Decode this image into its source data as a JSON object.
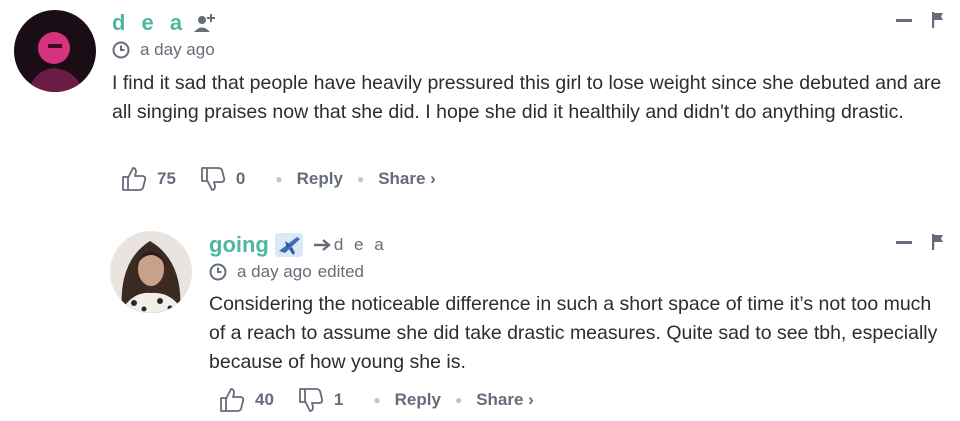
{
  "comments": [
    {
      "author": "d e a",
      "time": "a day ago",
      "text": "I find it sad that people have heavily pressured this girl to lose weight since she debuted and are all singing praises now that she did. I hope she did it healthily and didn't do anything drastic.",
      "upvotes": "75",
      "downvotes": "0",
      "reply_label": "Reply",
      "share_label": "Share ›"
    },
    {
      "author": "going",
      "reply_to": "d e a",
      "time": "a day ago",
      "edited": "edited",
      "text": "Considering the noticeable difference in such a short space of time it’s not too much of a reach to assume she did take drastic measures. Quite sad to see tbh, especially because of how young she is.",
      "upvotes": "40",
      "downvotes": "1",
      "reply_label": "Reply",
      "share_label": "Share ›"
    }
  ],
  "colors": {
    "author": "#4eb79f",
    "meta": "#656c7a",
    "text": "#2a2e2e"
  },
  "icons": [
    "follow-icon",
    "clock-icon",
    "thumbs-up-icon",
    "thumbs-down-icon",
    "collapse-icon",
    "flag-icon",
    "airplane-icon",
    "reply-arrow-icon"
  ]
}
